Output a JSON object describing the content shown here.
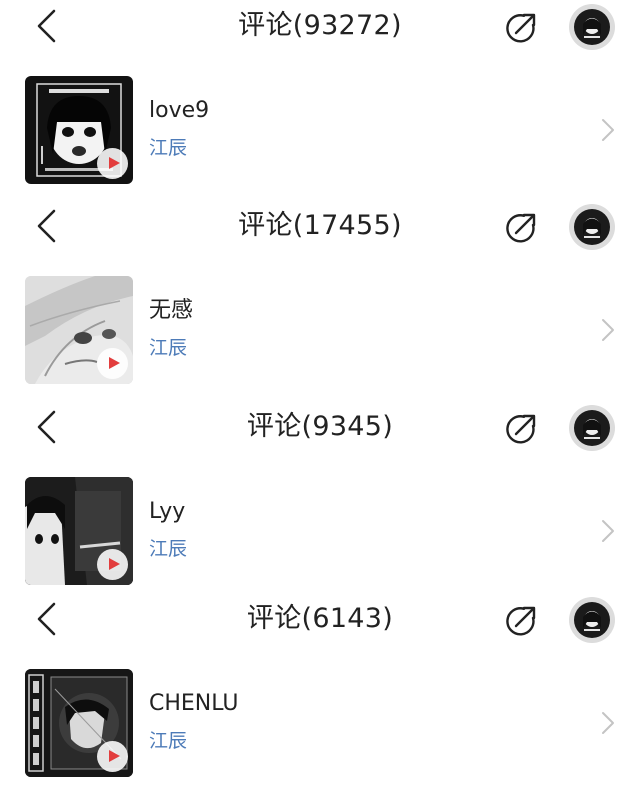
{
  "panels": [
    {
      "header": {
        "title": "评论(93272)"
      },
      "song": {
        "title": "love9",
        "artist": "江辰"
      }
    },
    {
      "header": {
        "title": "评论(17455)"
      },
      "song": {
        "title": "无感",
        "artist": "江辰"
      }
    },
    {
      "header": {
        "title": "评论(9345)"
      },
      "song": {
        "title": "Lyy",
        "artist": "江辰"
      }
    },
    {
      "header": {
        "title": "评论(6143)"
      },
      "song": {
        "title": "CHENLU",
        "artist": "江辰"
      }
    }
  ],
  "icons": {
    "back": "chevron-left-icon",
    "share": "share-icon",
    "play": "play-icon",
    "row_arrow": "chevron-right-icon"
  },
  "colors": {
    "artist_link": "#4d7bb8",
    "play_triangle": "#e23d3d",
    "chevron_gray": "#c4c4c4"
  }
}
